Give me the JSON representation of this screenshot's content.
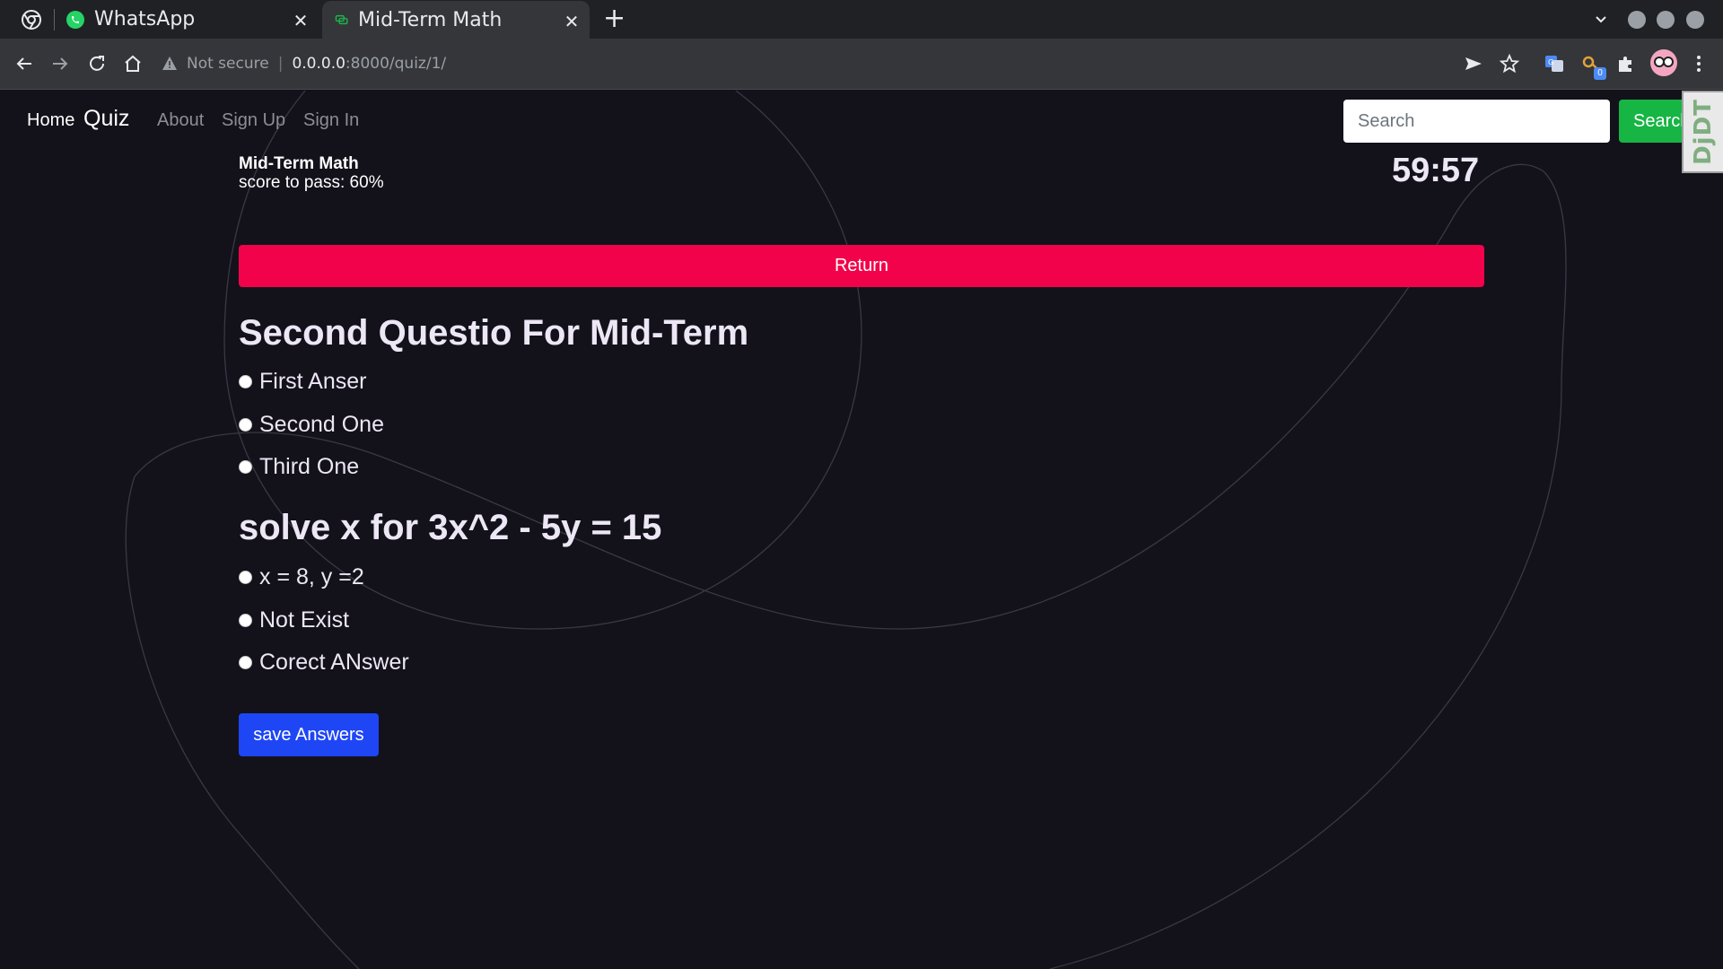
{
  "browser": {
    "tabs": [
      {
        "label": "WhatsApp",
        "active": false
      },
      {
        "label": "Mid-Term Math",
        "active": true
      }
    ],
    "address": {
      "security": "Not secure",
      "host": "0.0.0.0",
      "path": ":8000/quiz/1/"
    },
    "extension_badge": "0"
  },
  "nav": {
    "home": "Home",
    "brand": "Quiz",
    "links": [
      "About",
      "Sign Up",
      "Sign In"
    ],
    "search_placeholder": "Search",
    "search_button": "Search",
    "debug_toolbar": "DjDT"
  },
  "quiz": {
    "name": "Mid-Term Math",
    "pass_text": "score to pass: 60%",
    "timer": "59:57",
    "return_label": "Return",
    "questions": [
      {
        "text": "Second Questio For Mid-Term",
        "options": [
          "First Anser",
          "Second One",
          "Third One"
        ]
      },
      {
        "text": "solve x for 3x^2 - 5y = 15",
        "options": [
          "x = 8, y =2",
          "Not Exist",
          "Corect ANswer"
        ]
      }
    ],
    "save_label": "save Answers"
  },
  "colors": {
    "page_bg": "#13111a",
    "return": "#f2024a",
    "save": "#1e46f5",
    "search": "#17b544"
  }
}
